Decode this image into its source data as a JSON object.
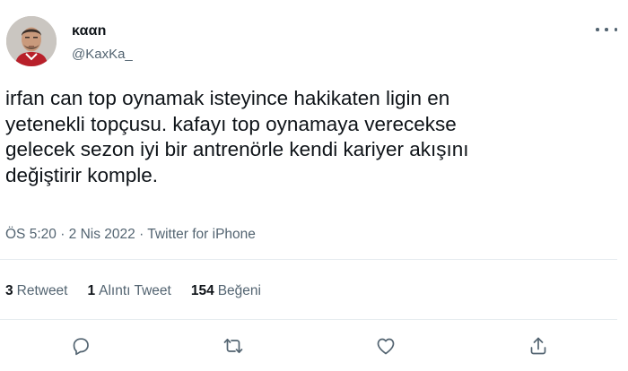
{
  "user": {
    "display_name": "κααn",
    "handle": "@KaxKa_"
  },
  "tweet": {
    "text": "irfan can top oynamak isteyince hakikaten ligin en\nyetenekli topçusu. kafayı top oynamaya verecekse\ngelecek sezon iyi bir antrenörle kendi kariyer akışını\ndeğiştirir komple.",
    "time": "ÖS 5:20",
    "date": "2 Nis 2022",
    "source": "Twitter for iPhone",
    "separator": "·"
  },
  "stats": {
    "retweets": {
      "count": "3",
      "label": "Retweet"
    },
    "quotes": {
      "count": "1",
      "label": "Alıntı Tweet"
    },
    "likes": {
      "count": "154",
      "label": "Beğeni"
    }
  },
  "actions": [
    {
      "name": "reply",
      "icon": "comment-icon"
    },
    {
      "name": "retweet",
      "icon": "retweet-icon"
    },
    {
      "name": "like",
      "icon": "heart-icon"
    },
    {
      "name": "share",
      "icon": "share-icon"
    }
  ],
  "colors": {
    "primary_text": "#0f1419",
    "secondary_text": "#536471",
    "divider": "#e6ecf0"
  }
}
